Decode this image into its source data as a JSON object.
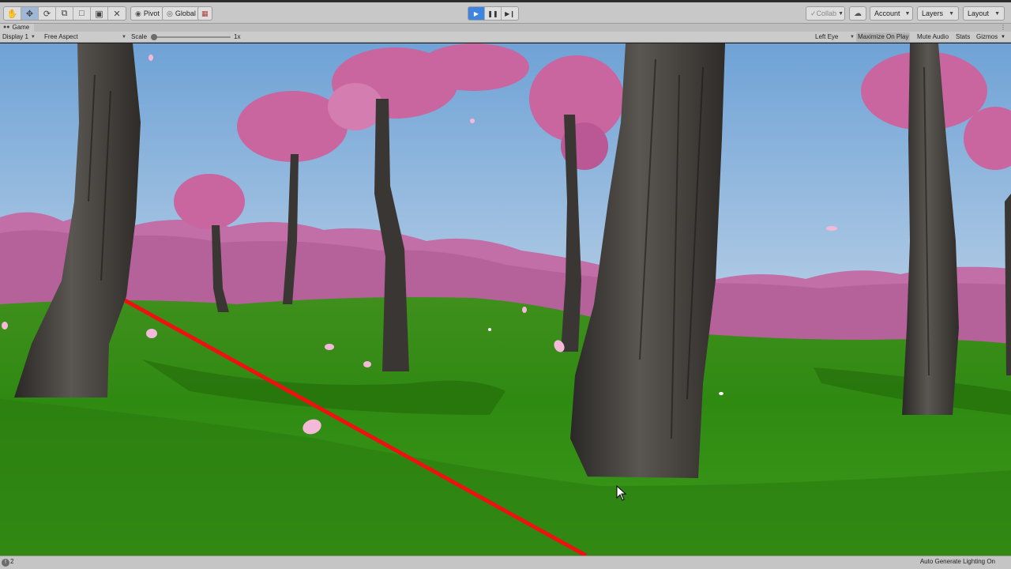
{
  "toolbar": {
    "pivot_label": "Pivot",
    "global_label": "Global",
    "collab_label": "Collab",
    "account_label": "Account",
    "layers_label": "Layers",
    "layout_label": "Layout"
  },
  "game_tab": {
    "title": "Game"
  },
  "game_controls": {
    "display": "Display 1",
    "aspect": "Free Aspect",
    "scale_label": "Scale",
    "scale_value": "1x",
    "scale_fraction": 0.0,
    "eye": "Left Eye",
    "maximize_on_play": "Maximize On Play",
    "mute_audio": "Mute Audio",
    "stats": "Stats",
    "gizmos": "Gizmos"
  },
  "status": {
    "count": "2",
    "right_text": "Auto Generate Lighting On"
  },
  "colors": {
    "play_active": "#3d85e0",
    "sky_top": "#6fa2d6",
    "sky_horizon": "#d8e5f0",
    "blossom": "#c9659f",
    "grass": "#2f8a12",
    "laser": "#ee1111"
  },
  "icons": {
    "hand": "hand-tool-icon",
    "move": "move-tool-icon",
    "rotate": "rotate-tool-icon",
    "scale": "scale-tool-icon",
    "rect": "rect-tool-icon",
    "transform": "transform-tool-icon",
    "custom": "custom-tool-icon",
    "play": "play-icon",
    "pause": "pause-icon",
    "step": "step-icon",
    "cloud": "cloud-icon"
  }
}
